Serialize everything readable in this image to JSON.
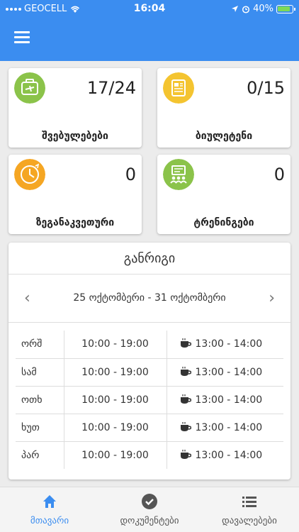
{
  "status_bar": {
    "carrier": "GEOCELL",
    "time": "16:04",
    "battery": "40%"
  },
  "stats": [
    {
      "value": "17/24",
      "label": "შვებულებები",
      "icon": "suitcase-icon",
      "color": "#8bc34a"
    },
    {
      "value": "0/15",
      "label": "ბიულეტენი",
      "icon": "document-icon",
      "color": "#f4c430"
    },
    {
      "value": "0",
      "label": "ზეგანაკვეთური",
      "icon": "clock-icon",
      "color": "#f5a623"
    },
    {
      "value": "0",
      "label": "ტრენინგები",
      "icon": "training-icon",
      "color": "#8bc34a"
    }
  ],
  "schedule": {
    "title": "განრიგი",
    "week_range": "25 ოქტომბერი - 31 ოქტომბერი",
    "rows": [
      {
        "day": "ორშ",
        "hours": "10:00 - 19:00",
        "break": "13:00 - 14:00"
      },
      {
        "day": "სამ",
        "hours": "10:00 - 19:00",
        "break": "13:00 - 14:00"
      },
      {
        "day": "ოთხ",
        "hours": "10:00 - 19:00",
        "break": "13:00 - 14:00"
      },
      {
        "day": "ხუთ",
        "hours": "10:00 - 19:00",
        "break": "13:00 - 14:00"
      },
      {
        "day": "პარ",
        "hours": "10:00 - 19:00",
        "break": "13:00 - 14:00"
      }
    ]
  },
  "tabs": [
    {
      "label": "მთავარი",
      "icon": "home-icon",
      "active": true
    },
    {
      "label": "დოკუმენტები",
      "icon": "check-circle-icon",
      "active": false
    },
    {
      "label": "დავალებები",
      "icon": "list-icon",
      "active": false
    }
  ],
  "colors": {
    "primary": "#3b8df0"
  }
}
